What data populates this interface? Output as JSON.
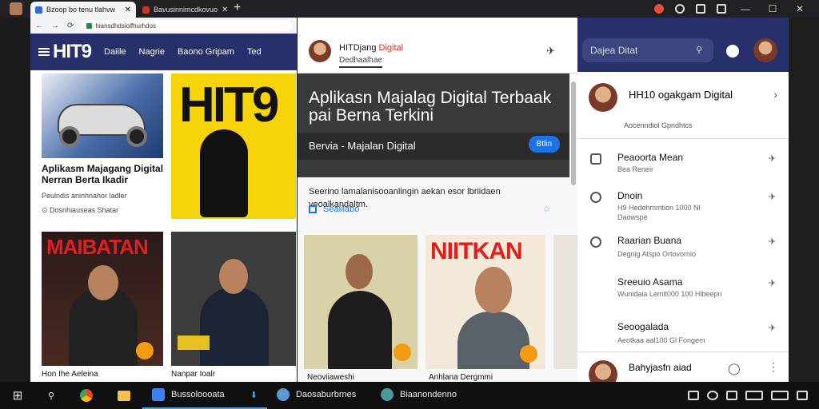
{
  "tabs": [
    {
      "label": "Bzoop bo tenu tlahvw",
      "active": true
    },
    {
      "label": "Bavusinnimcdkovuo",
      "active": false
    }
  ],
  "address_bar": {
    "url": "hiansdhdsiolfhurhdos"
  },
  "site_nav": {
    "logo": "HIT9",
    "items": [
      "Daiile",
      "Nagrie",
      "Baono Gripam",
      "Ted"
    ]
  },
  "articles": [
    {
      "title": "Aplikasm Majagang Digital Nerran Berta Ikadir",
      "meta": "Peulndis aninhnahor ladler",
      "time": "Dosnhiauseas Shatar"
    },
    {
      "title": "Hon Ihe Aeleina"
    },
    {
      "title": "Nanpar Ioalr"
    },
    {
      "title": "Neoviiaweshi"
    },
    {
      "title": "Anhlana Dergmmi"
    }
  ],
  "magazines": {
    "cover1": "HIT9",
    "cover2": "MAIBATAN",
    "cover3": "NIITKAN"
  },
  "detail_panel": {
    "title": "HITDjang",
    "title_accent": "Digital",
    "subtitle": "Dedhaalhae",
    "headline": "Aplikasn Majalag Digital Terbaak pai Berna Terkini",
    "category": "Bervia - Majalan Digital",
    "pill": "Btlin",
    "description": "Seerino lamalanisooanlingin aekan esor lbriidaen veoalkandaltm.",
    "link": "Sealilabo"
  },
  "right_panel": {
    "search_placeholder": "Dajea Ditat",
    "header_title": "HH10 ogakgam Digital",
    "header_sub": "Aocenndiol Gpndhtcs",
    "items": [
      {
        "title": "Peaoorta Mean",
        "sub": "Bea Reneir"
      },
      {
        "title": "Dnoin",
        "sub": "H9 Hedehmmtion 1000 NI Daowspe"
      },
      {
        "title": "Raarian Buana",
        "sub": "Degnig Atspo Ortovornio"
      },
      {
        "title": "Sreeuio Asama",
        "sub": "Wunidaia Lemit000 100 Hlbeepn"
      },
      {
        "title": "Seoogalada",
        "sub": "Aeotkaa aal100 Gl Fongem"
      }
    ],
    "footer": "Bahyjasfn aiad"
  },
  "taskbar": {
    "apps": [
      {
        "label": "Bussoloooata",
        "active": true
      },
      {
        "label": "Daosaburbrnes",
        "active": false
      },
      {
        "label": "Biaanondenno",
        "active": false
      }
    ]
  }
}
